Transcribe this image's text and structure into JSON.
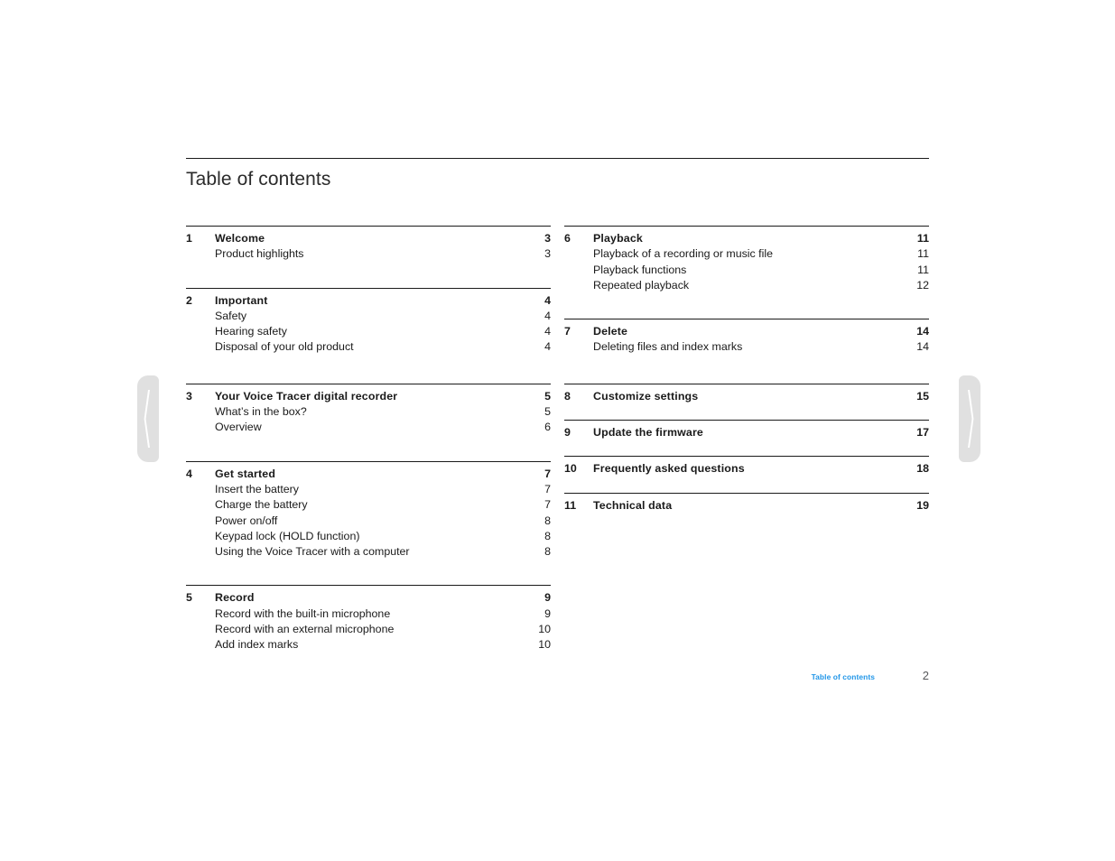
{
  "document": {
    "title": "Table of contents"
  },
  "nav": {
    "prev_page_label": "previous-page",
    "next_page_label": "next-page"
  },
  "footer": {
    "label": "Table of contents",
    "page_number": "2"
  },
  "colors": {
    "footer_link": "#2196e8",
    "rule": "#1a1a1a",
    "text": "#1a1a1a",
    "nav_tab": "#e0e0e0"
  },
  "columns": [
    {
      "groups": [
        {
          "chapter": {
            "num": "1",
            "label": "Welcome",
            "page": "3"
          },
          "subs": [
            {
              "label": "Product highlights",
              "page": "3"
            }
          ]
        },
        {
          "chapter": {
            "num": "2",
            "label": "Important",
            "page": "4"
          },
          "subs": [
            {
              "label": "Safety",
              "page": "4"
            },
            {
              "label": "Hearing safety",
              "page": "4"
            },
            {
              "label": "Disposal of your old product",
              "page": "4"
            }
          ]
        },
        {
          "chapter": {
            "num": "3",
            "label": "Your Voice Tracer digital recorder",
            "page": "5"
          },
          "subs": [
            {
              "label": "What’s in the box?",
              "page": "5"
            },
            {
              "label": "Overview",
              "page": "6"
            }
          ]
        },
        {
          "chapter": {
            "num": "4",
            "label": "Get started",
            "page": "7"
          },
          "subs": [
            {
              "label": "Insert the battery",
              "page": "7"
            },
            {
              "label": "Charge the battery",
              "page": "7"
            },
            {
              "label": "Power on/off",
              "page": "8"
            },
            {
              "label": "Keypad lock (HOLD function)",
              "page": "8"
            },
            {
              "label": "Using the Voice Tracer with a computer",
              "page": "8"
            }
          ]
        },
        {
          "chapter": {
            "num": "5",
            "label": "Record",
            "page": "9"
          },
          "subs": [
            {
              "label": "Record with the built-in microphone",
              "page": "9"
            },
            {
              "label": "Record with an external microphone",
              "page": "10"
            },
            {
              "label": "Add index marks",
              "page": "10"
            }
          ]
        }
      ]
    },
    {
      "groups": [
        {
          "chapter": {
            "num": "6",
            "label": "Playback",
            "page": "11"
          },
          "subs": [
            {
              "label": "Playback of a recording or music file",
              "page": "11"
            },
            {
              "label": "Playback functions",
              "page": "11"
            },
            {
              "label": "Repeated playback",
              "page": "12"
            }
          ]
        },
        {
          "chapter": {
            "num": "7",
            "label": "Delete",
            "page": "14"
          },
          "subs": [
            {
              "label": "Deleting files and index marks",
              "page": "14"
            }
          ]
        },
        {
          "chapter": {
            "num": "8",
            "label": "Customize settings",
            "page": "15"
          },
          "subs": []
        },
        {
          "chapter": {
            "num": "9",
            "label": "Update the firmware",
            "page": "17"
          },
          "subs": []
        },
        {
          "chapter": {
            "num": "10",
            "label": "Frequently asked questions",
            "page": "18"
          },
          "subs": []
        },
        {
          "chapter": {
            "num": "11",
            "label": "Technical data",
            "page": "19"
          },
          "subs": []
        }
      ]
    }
  ]
}
